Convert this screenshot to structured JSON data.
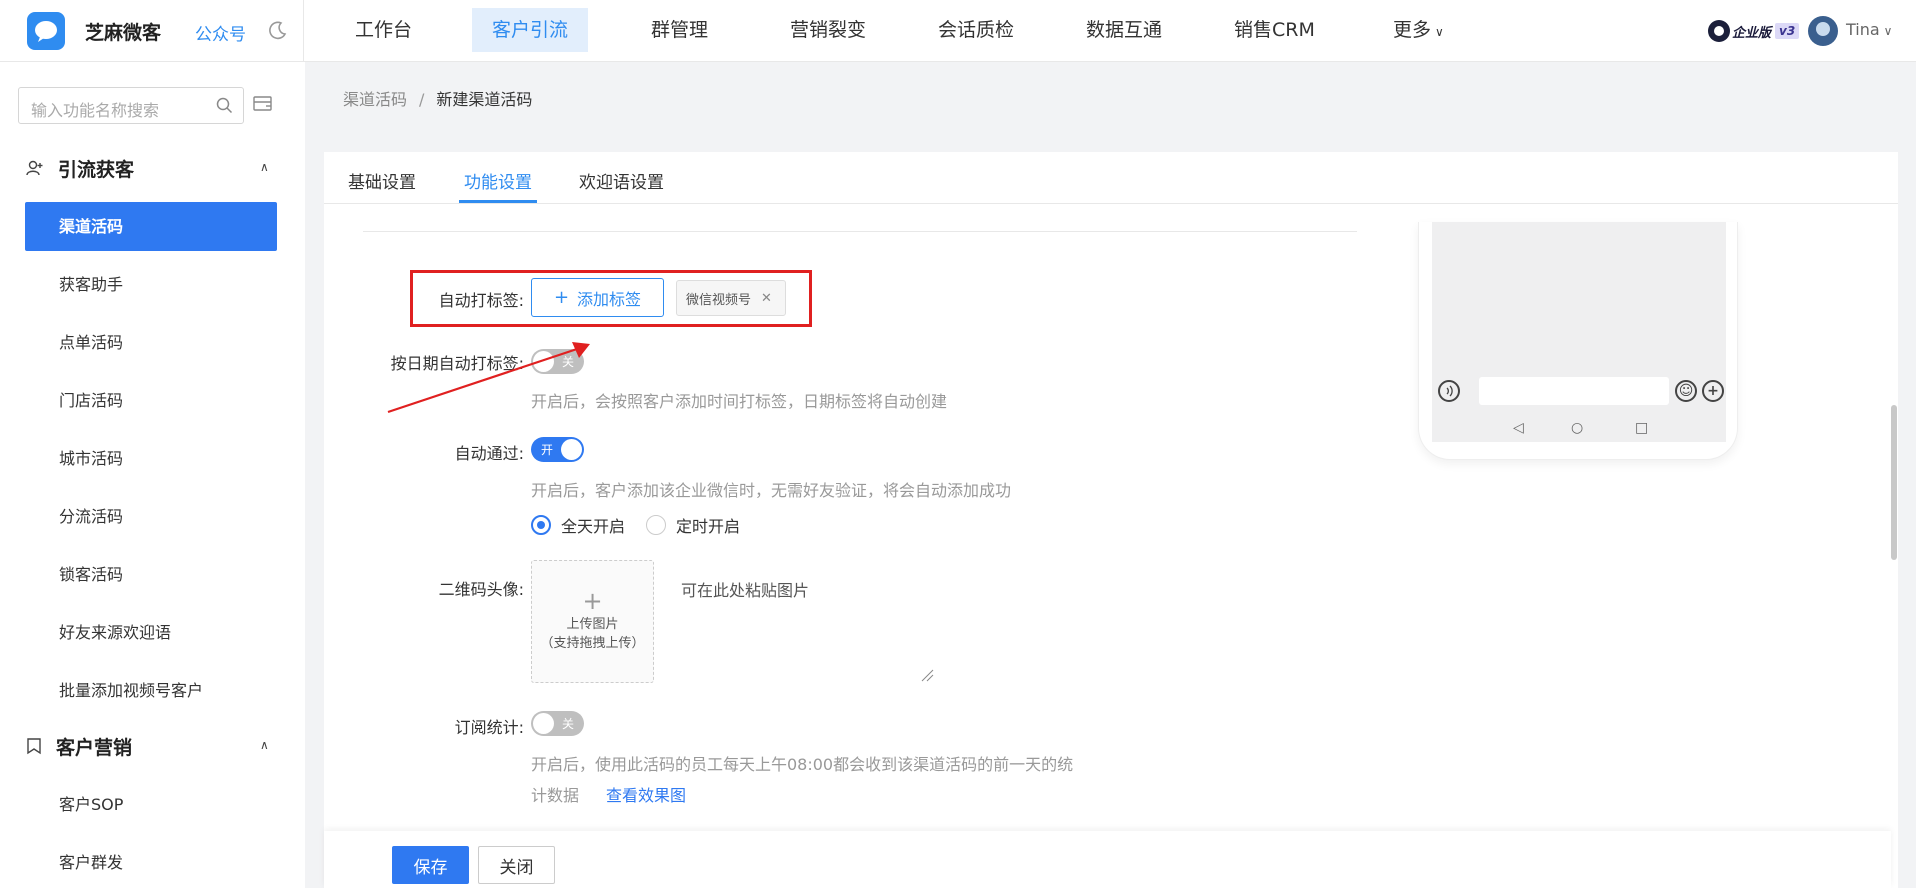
{
  "topbar": {
    "brand": "芝麻微客",
    "public_account": "公众号",
    "nav": [
      {
        "label": "工作台"
      },
      {
        "label": "客户引流"
      },
      {
        "label": "群管理"
      },
      {
        "label": "营销裂变"
      },
      {
        "label": "会话质检"
      },
      {
        "label": "数据互通"
      },
      {
        "label": "销售CRM"
      },
      {
        "label": "更多"
      }
    ],
    "edition": "企业版",
    "version": "v3",
    "user": "Tina"
  },
  "sidebar": {
    "search_placeholder": "输入功能名称搜索",
    "group1": "引流获客",
    "items1": [
      {
        "label": "渠道活码"
      },
      {
        "label": "获客助手"
      },
      {
        "label": "点单活码"
      },
      {
        "label": "门店活码"
      },
      {
        "label": "城市活码"
      },
      {
        "label": "分流活码"
      },
      {
        "label": "锁客活码"
      },
      {
        "label": "好友来源欢迎语"
      },
      {
        "label": "批量添加视频号客户"
      }
    ],
    "group2": "客户营销",
    "items2": [
      {
        "label": "客户SOP"
      },
      {
        "label": "客户群发"
      }
    ]
  },
  "breadcrumb": {
    "parent": "渠道活码",
    "sep": "/",
    "current": "新建渠道活码"
  },
  "tabs": [
    {
      "label": "基础设置"
    },
    {
      "label": "功能设置"
    },
    {
      "label": "欢迎语设置"
    }
  ],
  "form": {
    "auto_tag_label": "自动打标签:",
    "add_tag_button": "添加标签",
    "tag_chip": "微信视频号",
    "date_tag_label": "按日期自动打标签:",
    "date_tag_toggle": "关",
    "date_tag_hint": "开启后，会按照客户添加时间打标签，日期标签将自动创建",
    "auto_pass_label": "自动通过:",
    "auto_pass_toggle": "开",
    "auto_pass_hint": "开启后，客户添加该企业微信时，无需好友验证，将会自动添加成功",
    "radio_all_day": "全天开启",
    "radio_timed": "定时开启",
    "qr_avatar_label": "二维码头像:",
    "upload_line1": "上传图片",
    "upload_line2": "（支持拖拽上传）",
    "paste_text": "可在此处粘贴图片",
    "subscribe_label": "订阅统计:",
    "subscribe_toggle": "关",
    "subscribe_hint_line1": "开启后，使用此活码的员工每天上午08:00都会收到该渠道活码的前一天的统",
    "subscribe_hint_line2": "计数据",
    "view_effect_link": "查看效果图"
  },
  "footer": {
    "save": "保存",
    "close": "关闭"
  },
  "colors": {
    "primary": "#2f79f1",
    "annotation_red": "#e02020"
  }
}
